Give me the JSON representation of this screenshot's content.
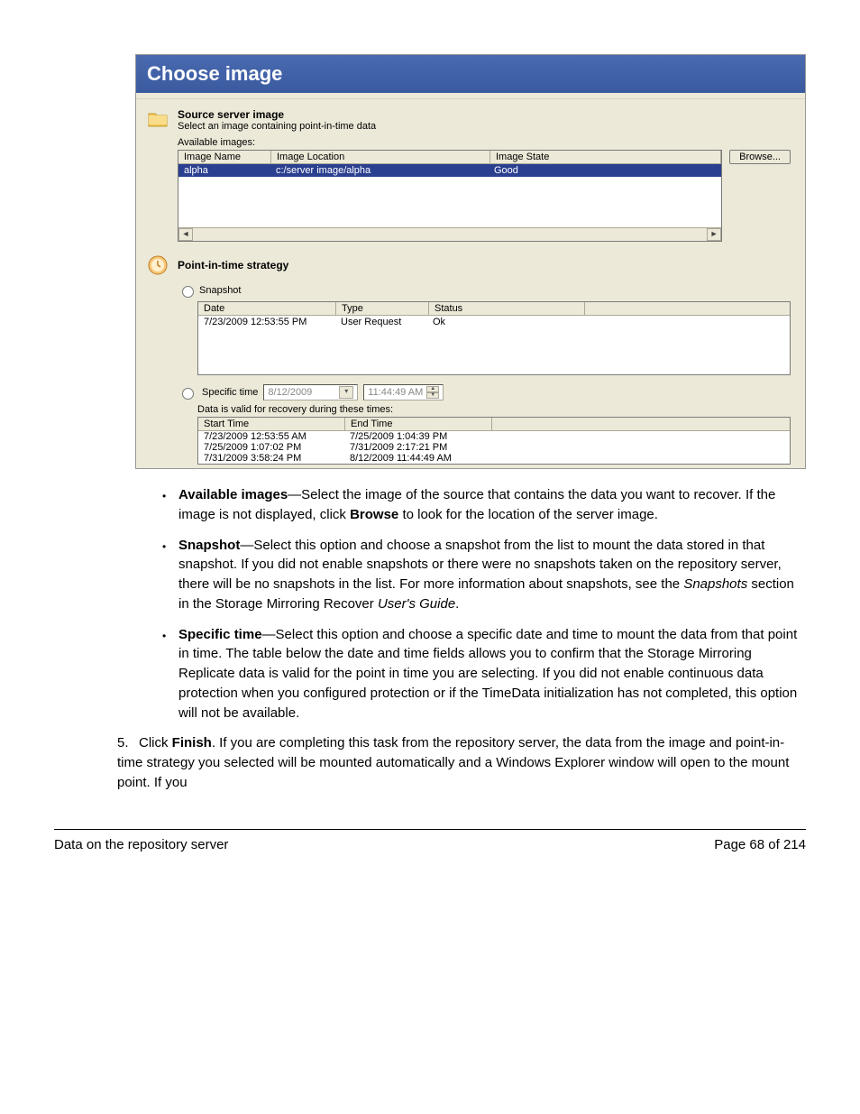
{
  "dialog": {
    "title": "Choose image",
    "source": {
      "heading": "Source server image",
      "sub": "Select an image containing point-in-time data",
      "available_label": "Available images:",
      "columns": {
        "c1": "Image Name",
        "c2": "Image Location",
        "c3": "Image State"
      },
      "row": {
        "c1": "alpha",
        "c2": "c:/server image/alpha",
        "c3": "Good"
      },
      "browse": "Browse..."
    },
    "pit": {
      "heading": "Point-in-time strategy"
    },
    "snapshot": {
      "label": "Snapshot",
      "columns": {
        "c1": "Date",
        "c2": "Type",
        "c3": "Status"
      },
      "row": {
        "c1": "7/23/2009 12:53:55 PM",
        "c2": "User Request",
        "c3": "Ok"
      }
    },
    "specific": {
      "label": "Specific time",
      "date": "8/12/2009",
      "time": "11:44:49 AM",
      "valid_label": "Data is valid for recovery during these times:",
      "columns": {
        "c1": "Start Time",
        "c2": "End Time"
      },
      "rows": [
        {
          "c1": "7/23/2009 12:53:55 AM",
          "c2": "7/25/2009 1:04:39 PM"
        },
        {
          "c1": "7/25/2009 1:07:02 PM",
          "c2": "7/31/2009 2:17:21 PM"
        },
        {
          "c1": "7/31/2009 3:58:24 PM",
          "c2": "8/12/2009 11:44:49 AM"
        }
      ]
    }
  },
  "doc": {
    "bullets": {
      "b1_lead": "Available images",
      "b1_text": "—Select the image of the source that contains the data you want to recover. If the image is not displayed, click ",
      "b1_bold2": "Browse",
      "b1_tail": " to look for the location of the server image.",
      "b2_lead": "Snapshot",
      "b2_text": "—Select this option and choose a snapshot from the list to mount the data stored in that snapshot. If you did not enable snapshots or there were no snapshots taken on the repository server, there will be no snapshots in the list. For more information about snapshots, see the ",
      "b2_ital": "Snapshots",
      "b2_mid": " section in the Storage Mirroring Recover ",
      "b2_ital2": "User's Guide",
      "b2_tail": ".",
      "b3_lead": "Specific time",
      "b3_text": "—Select this option and choose a specific date and time to mount the data from that point in time. The table below the date and time fields allows you to confirm that the Storage Mirroring Replicate data is valid for the point in time you are selecting. If you did not enable continuous data protection when you configured protection or if the TimeData initialization has not completed, this option will not be available."
    },
    "step5_num": "5.",
    "step5_pre": "Click ",
    "step5_bold": "Finish",
    "step5_tail": ". If you are completing this task from the repository server, the data from the image and point-in-time strategy you selected will be mounted automatically and a Windows Explorer window will open to the mount point. If you",
    "footer_left": "Data on the repository server",
    "footer_right": "Page 68 of 214"
  }
}
